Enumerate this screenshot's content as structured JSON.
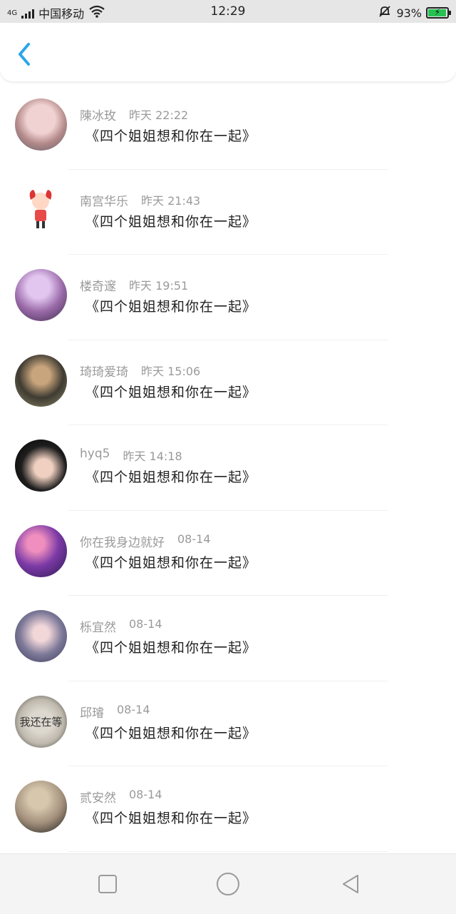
{
  "status": {
    "carrier": "中国移动",
    "network": "4G",
    "time": "12:29",
    "battery": "93%"
  },
  "header": {
    "back_icon": "chevron-left-icon"
  },
  "messages": [
    {
      "name": "陳冰玫",
      "time": "昨天 22:22",
      "text": "《四个姐姐想和你在一起》",
      "avatar_color": "#d7a7a7"
    },
    {
      "name": "南宫华乐",
      "time": "昨天 21:43",
      "text": "《四个姐姐想和你在一起》",
      "avatar_color": "#ffffff"
    },
    {
      "name": "楼奇邃",
      "time": "昨天 19:51",
      "text": "《四个姐姐想和你在一起》",
      "avatar_color": "#9a6aa8"
    },
    {
      "name": "琦琦爱琦",
      "time": "昨天 15:06",
      "text": "《四个姐姐想和你在一起》",
      "avatar_color": "#4b4a3c"
    },
    {
      "name": "hyq5",
      "time": "昨天 14:18",
      "text": "《四个姐姐想和你在一起》",
      "avatar_color": "#2b2b2b"
    },
    {
      "name": "你在我身边就好",
      "time": "08-14",
      "text": "《四个姐姐想和你在一起》",
      "avatar_color": "#7b3aa6"
    },
    {
      "name": "栎宜然",
      "time": "08-14",
      "text": "《四个姐姐想和你在一起》",
      "avatar_color": "#7c7898"
    },
    {
      "name": "邱璿",
      "time": "08-14",
      "text": "《四个姐姐想和你在一起》",
      "avatar_color": "#bfb9ad"
    },
    {
      "name": "贰安然",
      "time": "08-14",
      "text": "《四个姐姐想和你在一起》",
      "avatar_color": "#a3907c"
    }
  ],
  "avatar_icon_text": {
    "item8": "我还在等"
  },
  "navbar": {
    "recent_icon": "square-icon",
    "home_icon": "circle-icon",
    "back_icon": "triangle-back-icon"
  }
}
